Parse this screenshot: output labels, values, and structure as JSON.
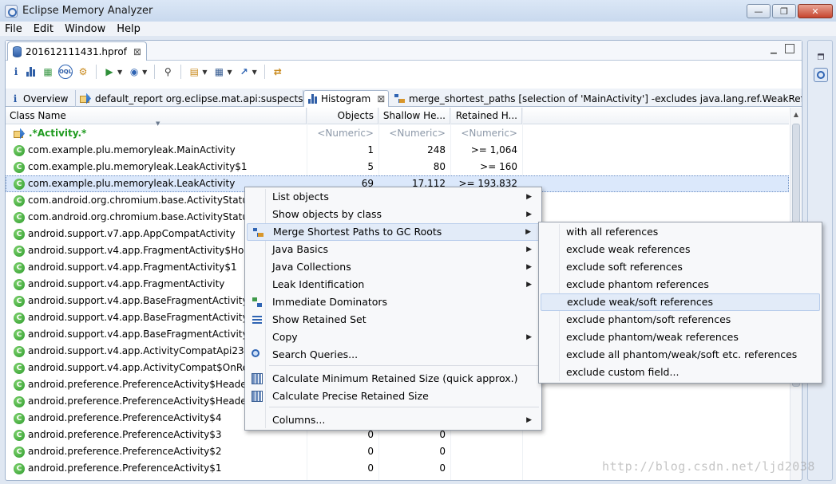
{
  "window": {
    "title": "Eclipse Memory Analyzer",
    "minimize_glyph": "—",
    "maximize_glyph": "❐",
    "close_glyph": "✕"
  },
  "menubar": [
    "File",
    "Edit",
    "Window",
    "Help"
  ],
  "editor_tab": {
    "label": "201612111431.hprof",
    "close": "⊠"
  },
  "toolbar": {
    "sql_label": "OQL"
  },
  "inner_tabs": [
    {
      "label": "Overview"
    },
    {
      "label": "default_report  org.eclipse.mat.api:suspects"
    },
    {
      "label": "Histogram",
      "close": "⊠"
    },
    {
      "label": "merge_shortest_paths [selection of 'MainActivity'] -excludes java.lang.ref.WeakRefe..."
    }
  ],
  "table": {
    "headers": [
      "Class Name",
      "Objects",
      "Shallow He...",
      "Retained H..."
    ],
    "filter_row": {
      "name": ".*Activity.*",
      "objects": "<Numeric>",
      "shallow": "<Numeric>",
      "retained": "<Numeric>"
    },
    "rows": [
      {
        "name": "com.example.plu.memoryleak.MainActivity",
        "objects": "1",
        "shallow": "248",
        "retained": ">= 1,064"
      },
      {
        "name": "com.example.plu.memoryleak.LeakActivity$1",
        "objects": "5",
        "shallow": "80",
        "retained": ">= 160"
      },
      {
        "name": "com.example.plu.memoryleak.LeakActivity",
        "objects": "69",
        "shallow": "17,112",
        "retained": ">= 193,832"
      },
      {
        "name": "com.android.org.chromium.base.ActivityStatus$",
        "objects": "",
        "shallow": "",
        "retained": ""
      },
      {
        "name": "com.android.org.chromium.base.ActivityStatus",
        "objects": "",
        "shallow": "",
        "retained": ""
      },
      {
        "name": "android.support.v7.app.AppCompatActivity",
        "objects": "",
        "shallow": "",
        "retained": ""
      },
      {
        "name": "android.support.v4.app.FragmentActivity$HostC",
        "objects": "",
        "shallow": "",
        "retained": ""
      },
      {
        "name": "android.support.v4.app.FragmentActivity$1",
        "objects": "",
        "shallow": "",
        "retained": ""
      },
      {
        "name": "android.support.v4.app.FragmentActivity",
        "objects": "",
        "shallow": "",
        "retained": ""
      },
      {
        "name": "android.support.v4.app.BaseFragmentActivityJE",
        "objects": "",
        "shallow": "",
        "retained": ""
      },
      {
        "name": "android.support.v4.app.BaseFragmentActivityH",
        "objects": "",
        "shallow": "",
        "retained": ""
      },
      {
        "name": "android.support.v4.app.BaseFragmentActivityG",
        "objects": "",
        "shallow": "",
        "retained": ""
      },
      {
        "name": "android.support.v4.app.ActivityCompatApi23$R",
        "objects": "",
        "shallow": "",
        "retained": ""
      },
      {
        "name": "android.support.v4.app.ActivityCompat$OnReq",
        "objects": "",
        "shallow": "",
        "retained": ""
      },
      {
        "name": "android.preference.PreferenceActivity$HeaderA",
        "objects": "",
        "shallow": "",
        "retained": ""
      },
      {
        "name": "android.preference.PreferenceActivity$Header",
        "objects": "",
        "shallow": "",
        "retained": ""
      },
      {
        "name": "android.preference.PreferenceActivity$4",
        "objects": "",
        "shallow": "",
        "retained": ""
      },
      {
        "name": "android.preference.PreferenceActivity$3",
        "objects": "0",
        "shallow": "0",
        "retained": ""
      },
      {
        "name": "android.preference.PreferenceActivity$2",
        "objects": "0",
        "shallow": "0",
        "retained": ""
      },
      {
        "name": "android.preference.PreferenceActivity$1",
        "objects": "0",
        "shallow": "0",
        "retained": ""
      }
    ]
  },
  "context_menu": {
    "items": [
      {
        "label": "List objects",
        "submenu": true
      },
      {
        "label": "Show objects by class",
        "submenu": true
      },
      {
        "label": "Merge Shortest Paths to GC Roots",
        "submenu": true,
        "icon": "tree-icon",
        "hover": true
      },
      {
        "label": "Java Basics",
        "submenu": true
      },
      {
        "label": "Java Collections",
        "submenu": true
      },
      {
        "label": "Leak Identification",
        "submenu": true
      },
      {
        "label": "Immediate Dominators",
        "submenu": false,
        "icon": "dominator-icon"
      },
      {
        "label": "Show Retained Set",
        "submenu": false,
        "icon": "retained-set-icon"
      },
      {
        "label": "Copy",
        "submenu": true
      },
      {
        "label": "Search Queries...",
        "submenu": false,
        "icon": "search-query-icon"
      },
      {
        "label": "Calculate Minimum Retained Size (quick approx.)",
        "submenu": false,
        "icon": "calculator-icon"
      },
      {
        "label": "Calculate Precise Retained Size",
        "submenu": false,
        "icon": "calculator-icon"
      },
      {
        "label": "Columns...",
        "submenu": true
      }
    ],
    "submenu_arrow": "▶"
  },
  "submenu": {
    "items": [
      "with all references",
      "exclude weak references",
      "exclude soft references",
      "exclude phantom references",
      "exclude weak/soft references",
      "exclude phantom/soft references",
      "exclude phantom/weak references",
      "exclude all phantom/weak/soft etc. references",
      "exclude custom field..."
    ],
    "hover_index": 4
  },
  "watermark": "http://blog.csdn.net/ljd2038"
}
